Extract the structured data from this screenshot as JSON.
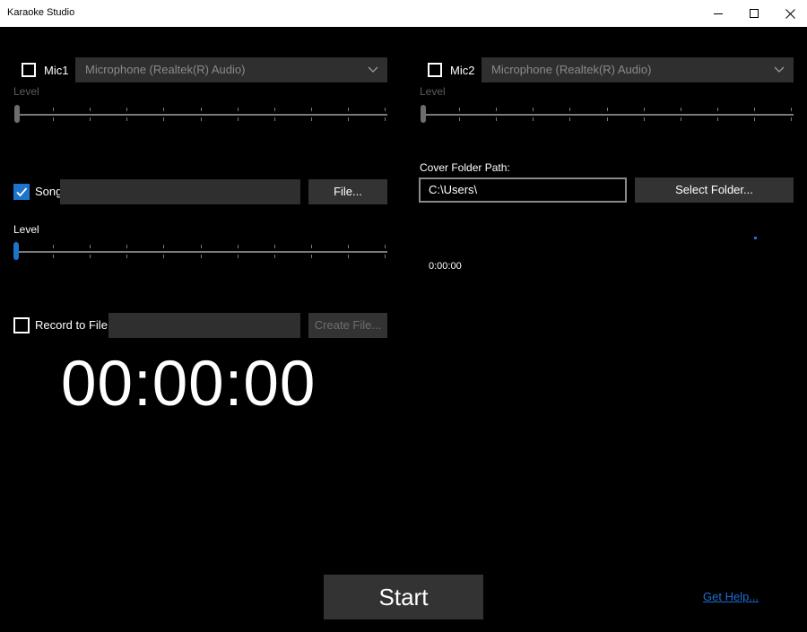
{
  "window": {
    "title": "Karaoke Studio"
  },
  "mic1": {
    "label": "Mic1",
    "checked": false,
    "device": "Microphone (Realtek(R) Audio)",
    "level_label": "Level"
  },
  "mic2": {
    "label": "Mic2",
    "checked": false,
    "device": "Microphone (Realtek(R) Audio)",
    "level_label": "Level"
  },
  "song": {
    "label": "Song",
    "checked": true,
    "path": "",
    "file_button": "File...",
    "level_label": "Level"
  },
  "cover": {
    "label": "Cover Folder Path:",
    "path": "C:\\Users\\",
    "select_button": "Select Folder..."
  },
  "playback": {
    "time": "0:00:00"
  },
  "record": {
    "label": "Record to File:",
    "checked": false,
    "path": "",
    "create_button": "Create File..."
  },
  "timer": {
    "value": "00:00:00"
  },
  "actions": {
    "start": "Start",
    "help": "Get Help..."
  },
  "colors": {
    "accent": "#1c74cc",
    "background": "#000000",
    "control": "#2f2f2f",
    "link": "#1a6fd1"
  },
  "icons": {
    "minimize": "minimize-icon",
    "maximize": "maximize-icon",
    "close": "close-icon",
    "dropdown": "chevron-down-icon",
    "check": "checkmark-icon"
  }
}
